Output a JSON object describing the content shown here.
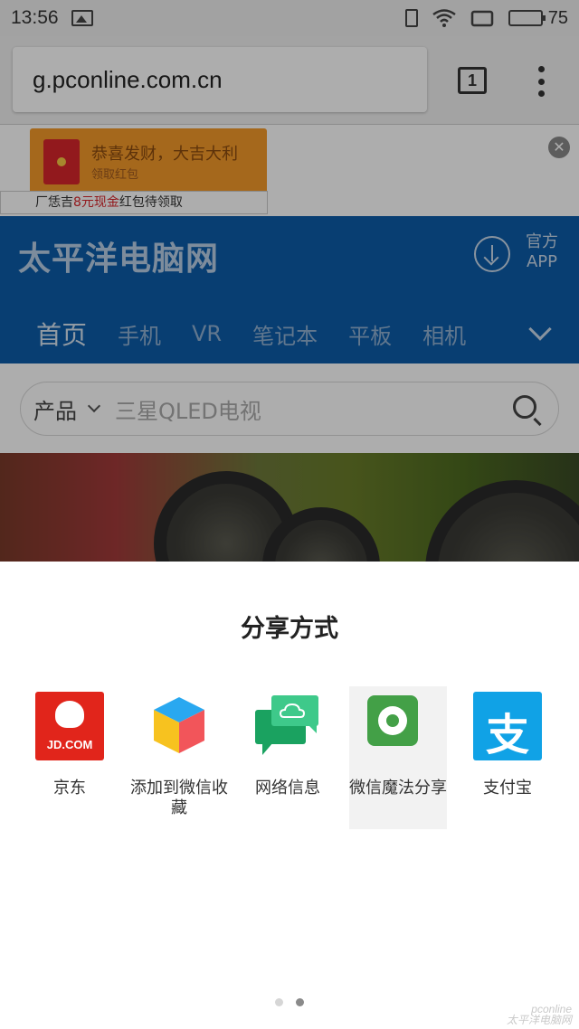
{
  "status_bar": {
    "time": "13:56",
    "battery": "75",
    "battery_level": 0.75
  },
  "browser": {
    "url": "g.pconline.com.cn",
    "tab_count": "1"
  },
  "ad": {
    "popup_title": "恭喜发财，大吉大利",
    "popup_sub": "领取红包",
    "bar_prefix": "恁吉",
    "bar_highlight": "8元现金",
    "bar_suffix": "红包待领取",
    "bar_lead": "厂"
  },
  "site": {
    "logo": "太平洋电脑网",
    "app_label_1": "官方",
    "app_label_2": "APP",
    "nav": [
      "首页",
      "手机",
      "VR",
      "笔记本",
      "平板",
      "相机"
    ]
  },
  "search": {
    "category": "产品",
    "placeholder": "三星QLED电视"
  },
  "share_sheet": {
    "title": "分享方式",
    "items": [
      {
        "label": "京东",
        "icon": "jd-icon",
        "icon_text": "JD.COM"
      },
      {
        "label": "添加到微信收藏",
        "icon": "wechat-favorites-cube-icon"
      },
      {
        "label": "网络信息",
        "icon": "chat-bubbles-icon"
      },
      {
        "label": "微信魔法分享",
        "icon": "camera-shutter-icon"
      },
      {
        "label": "支付宝",
        "icon": "alipay-icon",
        "icon_text": "支"
      }
    ],
    "page_dots": 2,
    "active_dot": 2
  },
  "watermark": {
    "line1": "pconline",
    "line2": "太平洋电脑网"
  },
  "colors": {
    "site_header": "#0d5ca8",
    "jd_red": "#e1251b",
    "alipay_blue": "#10a2e6",
    "wechat_green": "#43a047"
  }
}
